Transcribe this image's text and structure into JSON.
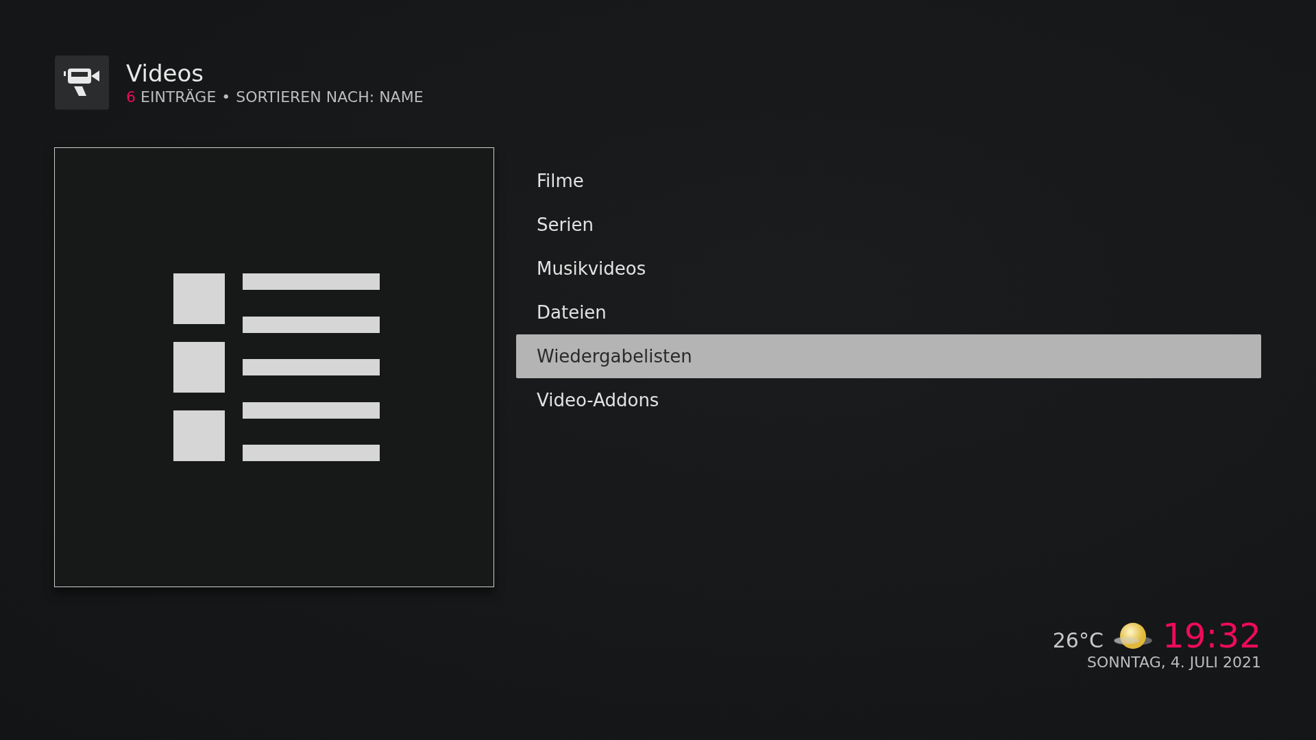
{
  "header": {
    "title": "Videos",
    "count": "6",
    "count_label": "EINTRÄGE",
    "separator": "•",
    "sort_label": "SORTIEREN NACH: NAME"
  },
  "menu": [
    {
      "label": "Filme",
      "selected": false
    },
    {
      "label": "Serien",
      "selected": false
    },
    {
      "label": "Musikvideos",
      "selected": false
    },
    {
      "label": "Dateien",
      "selected": false
    },
    {
      "label": "Wiedergabelisten",
      "selected": true
    },
    {
      "label": "Video-Addons",
      "selected": false
    }
  ],
  "status": {
    "temperature": "26°C",
    "time": "19:32",
    "date": "SONNTAG, 4. JULI 2021"
  }
}
